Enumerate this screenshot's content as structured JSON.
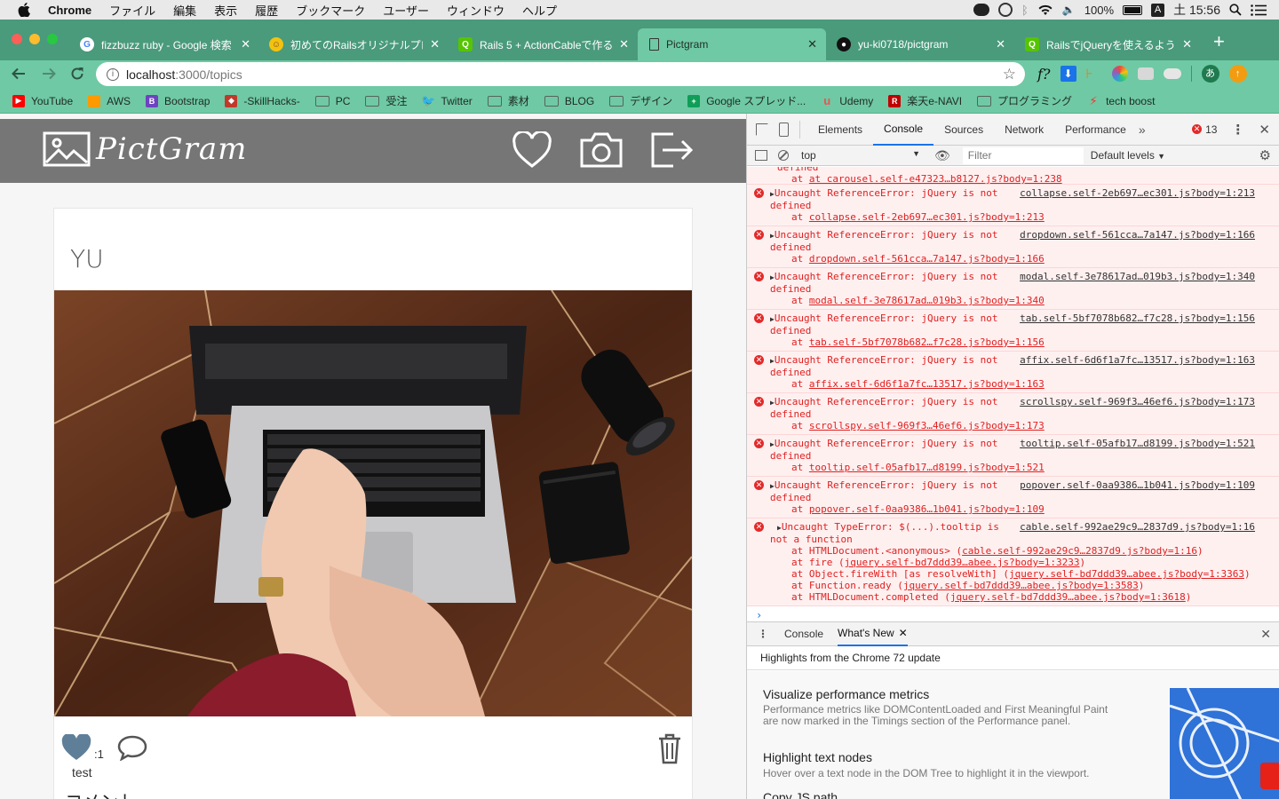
{
  "menubar": {
    "app_name": "Chrome",
    "menus": [
      "ファイル",
      "編集",
      "表示",
      "履歴",
      "ブックマーク",
      "ユーザー",
      "ウィンドウ",
      "ヘルプ"
    ],
    "battery": "100%",
    "input_mode": "A",
    "clock": "土 15:56"
  },
  "tabs": [
    {
      "title": "fizzbuzz ruby - Google 検索",
      "icon": "google-icon"
    },
    {
      "title": "初めてのRailsオリジナルプロ",
      "icon": "qiita-icon"
    },
    {
      "title": "Rails 5 + ActionCableで作る",
      "icon": "qiita-green-icon"
    },
    {
      "title": "Pictgram",
      "icon": "page-icon"
    },
    {
      "title": "yu-ki0718/pictgram",
      "icon": "github-icon"
    },
    {
      "title": "RailsでjQueryを使えるように",
      "icon": "qiita-green-icon"
    }
  ],
  "omnibox": {
    "host": "localhost",
    "path": ":3000/topics"
  },
  "bookmarks": [
    {
      "label": "YouTube",
      "type": "youtube",
      "color": "#ff0000"
    },
    {
      "label": "AWS",
      "type": "aws",
      "color": "#f90"
    },
    {
      "label": "Bootstrap",
      "type": "bootstrap",
      "color": "#6f42c1"
    },
    {
      "label": "-SkillHacks-",
      "type": "gem",
      "color": "#c0392b"
    },
    {
      "label": "PC",
      "type": "folder"
    },
    {
      "label": "受注",
      "type": "folder"
    },
    {
      "label": "Twitter",
      "type": "twitter",
      "color": "#1da1f2"
    },
    {
      "label": "素材",
      "type": "folder"
    },
    {
      "label": "BLOG",
      "type": "folder"
    },
    {
      "label": "デザイン",
      "type": "folder"
    },
    {
      "label": "Google スプレッド...",
      "type": "sheets",
      "color": "#0f9d58"
    },
    {
      "label": "Udemy",
      "type": "udemy",
      "color": "#ec5252"
    },
    {
      "label": "楽天e-NAVI",
      "type": "rakuten",
      "color": "#bf0000"
    },
    {
      "label": "プログラミング",
      "type": "folder"
    },
    {
      "label": "tech boost",
      "type": "techboost",
      "color": "#e53935"
    }
  ],
  "site": {
    "logo_text": "PictGram",
    "post": {
      "user_name": "YU",
      "like_count": ":1",
      "description": "test",
      "comment_heading": "コメント"
    }
  },
  "devtools": {
    "tabs": [
      "Elements",
      "Console",
      "Sources",
      "Network",
      "Performance"
    ],
    "active_tab": "Console",
    "error_count": "13",
    "context": "top",
    "filter_placeholder": "Filter",
    "levels": "Default levels",
    "truncated_first": {
      "text": "at carousel.self-e47323…b8127.js?body=1:238"
    },
    "errors": [
      {
        "message": "Uncaught ReferenceError: jQuery is not",
        "message2": "defined",
        "source": "collapse.self-2eb697…ec301.js?body=1:213",
        "at": "collapse.self-2eb697…ec301.js?body=1:213"
      },
      {
        "message": "Uncaught ReferenceError: jQuery is not",
        "message2": "defined",
        "source": "dropdown.self-561cca…7a147.js?body=1:166",
        "at": "dropdown.self-561cca…7a147.js?body=1:166"
      },
      {
        "message": "Uncaught ReferenceError: jQuery is not",
        "message2": "defined",
        "source": "modal.self-3e78617ad…019b3.js?body=1:340",
        "at": "modal.self-3e78617ad…019b3.js?body=1:340"
      },
      {
        "message": "Uncaught ReferenceError: jQuery is not",
        "message2": "defined",
        "source": "tab.self-5bf7078b682…f7c28.js?body=1:156",
        "at": "tab.self-5bf7078b682…f7c28.js?body=1:156"
      },
      {
        "message": "Uncaught ReferenceError: jQuery is not",
        "message2": "defined",
        "source": "affix.self-6d6f1a7fc…13517.js?body=1:163",
        "at": "affix.self-6d6f1a7fc…13517.js?body=1:163"
      },
      {
        "message": "Uncaught ReferenceError: jQuery is not",
        "message2": "defined",
        "source": "scrollspy.self-969f3…46ef6.js?body=1:173",
        "at": "scrollspy.self-969f3…46ef6.js?body=1:173"
      },
      {
        "message": "Uncaught ReferenceError: jQuery is not",
        "message2": "defined",
        "source": "tooltip.self-05afb17…d8199.js?body=1:521",
        "at": "tooltip.self-05afb17…d8199.js?body=1:521"
      },
      {
        "message": "Uncaught ReferenceError: jQuery is not",
        "message2": "defined",
        "source": "popover.self-0aa9386…1b041.js?body=1:109",
        "at": "popover.self-0aa9386…1b041.js?body=1:109"
      }
    ],
    "type_error": {
      "message": "Uncaught TypeError: $(...).tooltip is",
      "message2": "not a function",
      "source": "cable.self-992ae29c9…2837d9.js?body=1:16",
      "stack": [
        {
          "fn": "HTMLDocument.<anonymous>",
          "link": "cable.self-992ae29c9…2837d9.js?body=1:16"
        },
        {
          "fn": "fire",
          "link": "jquery.self-bd7ddd39…abee.js?body=1:3233"
        },
        {
          "fn": "Object.fireWith [as resolveWith]",
          "link": "jquery.self-bd7ddd39…abee.js?body=1:3363"
        },
        {
          "fn": "Function.ready",
          "link": "jquery.self-bd7ddd39…abee.js?body=1:3583"
        },
        {
          "fn": "HTMLDocument.completed",
          "link": "jquery.self-bd7ddd39…abee.js?body=1:3618"
        }
      ]
    },
    "drawer": {
      "tabs": [
        "Console",
        "What's New"
      ],
      "active": "What's New",
      "subtitle": "Highlights from the Chrome 72 update",
      "items": [
        {
          "title": "Visualize performance metrics",
          "desc": "Performance metrics like DOMContentLoaded and First Meaningful Paint are now marked in the Timings section of the Performance panel."
        },
        {
          "title": "Highlight text nodes",
          "desc": "Hover over a text node in the DOM Tree to highlight it in the viewport."
        },
        {
          "title": "Copy JS path",
          "desc": ""
        }
      ]
    }
  }
}
